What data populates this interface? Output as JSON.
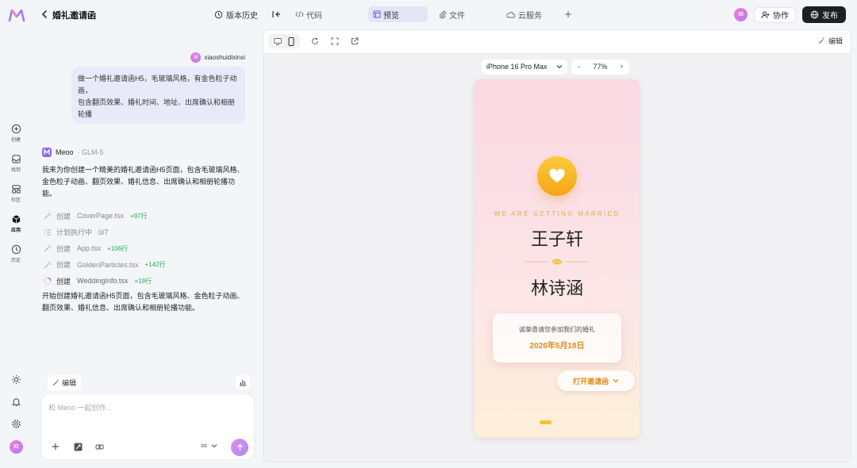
{
  "header": {
    "title": "婚礼邀请函",
    "history_label": "版本历史",
    "tabs": [
      {
        "label": "代码",
        "icon": "code-icon"
      },
      {
        "label": "预览",
        "icon": "preview-icon",
        "active": true
      },
      {
        "label": "文件",
        "icon": "paperclip-icon"
      },
      {
        "label": "云服务",
        "icon": "cloud-icon"
      }
    ],
    "user_initials": "XI",
    "collab_label": "协作",
    "publish_label": "发布"
  },
  "sidebar": {
    "items": [
      {
        "label": "创建",
        "icon": "plus-circle-icon"
      },
      {
        "label": "找到",
        "icon": "inbox-icon"
      },
      {
        "label": "社区",
        "icon": "grid-icon"
      },
      {
        "label": "应用",
        "icon": "cube-icon",
        "active": true
      },
      {
        "label": "历史",
        "icon": "clock-icon"
      }
    ],
    "user_initials": "XI"
  },
  "chat": {
    "user_name": "xiaoshuidixinxi",
    "user_initials": "XI",
    "user_message_lines": [
      "做一个婚礼邀请函H5，毛玻璃风格，有金色粒子动",
      "画，",
      "包含翻页效果、婚礼时间、地址、出席确认和相册",
      "轮播"
    ],
    "ai_name": "Meoo",
    "ai_model": "· GLM-5",
    "ai_intro_lines": [
      "我来为你创建一个精美的婚礼邀请函H5页面，包含毛玻璃风格、",
      "金色粒子动画、翻页效果、婚礼信息、出席确认和相册轮播功",
      "能。"
    ],
    "steps": [
      {
        "action": "创建",
        "file": "CoverPage.tsx",
        "added": "+97行"
      },
      {
        "action": "计划执行中",
        "file": "0/7",
        "added": ""
      },
      {
        "action": "创建",
        "file": "App.tsx",
        "added": "+106行"
      },
      {
        "action": "创建",
        "file": "GoldenParticles.tsx",
        "added": "+142行"
      },
      {
        "action": "创建",
        "file": "WeddingInfo.tsx",
        "added": "+19行"
      }
    ],
    "ai_outro_lines": [
      "开始创建婚礼邀请函H5页面，包含毛玻璃风格、金色粒子动画、",
      "翻页效果、婚礼信息、出席确认和相册轮播功能。"
    ],
    "edit_label": "编辑",
    "input_placeholder": "和 Meoo 一起创作...",
    "model_symbol": "∞"
  },
  "preview": {
    "edit_label": "编辑",
    "device": "iPhone 16 Pro Max",
    "zoom": "77%",
    "invitation": {
      "tagline": "WE ARE GETTING MARRIED",
      "groom": "王子轩",
      "bride": "林诗涵",
      "invite_text": "诚挚邀请您参加我们的婚礼",
      "date": "2026年5月18日",
      "open_label": "打开邀请函"
    }
  },
  "colors": {
    "accent_gold": "#f6a416",
    "text_gold": "#e08a1c",
    "avatar_gradient": "#ee7bd8",
    "active_tab_bg": "#e4e5f7",
    "publish_bg": "#1d1f24"
  }
}
